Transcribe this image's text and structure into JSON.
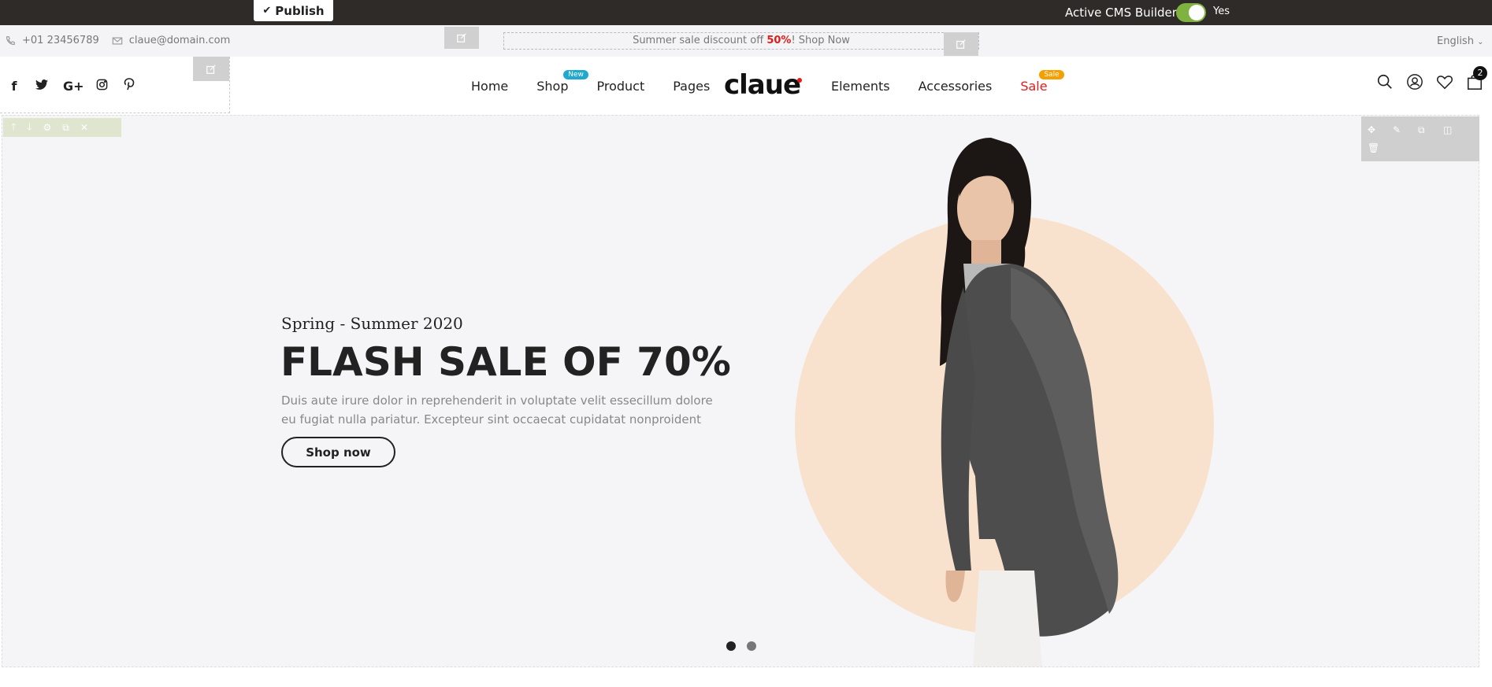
{
  "cms": {
    "publish_label": "Publish",
    "builder_label": "Active CMS Builder",
    "toggle_state": "Yes"
  },
  "topbar": {
    "phone": "+01 23456789",
    "email": "claue@domain.com",
    "promo_prefix": "Summer sale discount off ",
    "promo_highlight": "50%",
    "promo_suffix": "! Shop Now",
    "language": "English"
  },
  "nav": {
    "items": [
      {
        "label": "Home"
      },
      {
        "label": "Shop",
        "badge": "New"
      },
      {
        "label": "Product"
      },
      {
        "label": "Pages"
      }
    ],
    "logo": "claue",
    "items_right": [
      {
        "label": "Elements"
      },
      {
        "label": "Accessories"
      },
      {
        "label": "Sale",
        "badge": "Sale"
      }
    ],
    "cart_count": "2"
  },
  "colors": {
    "accent_red": "#e31b1b",
    "new_badge": "#21a8cf",
    "sale_badge": "#f5a000",
    "toggle_on": "#7fb241"
  },
  "hero": {
    "subheading": "Spring - Summer 2020",
    "headline": "FLASH SALE OF 70%",
    "body": "Duis aute irure dolor in reprehenderit in voluptate velit essecillum dolore eu fugiat nulla pariatur. Excepteur sint occaecat cupidatat nonproident",
    "cta": "Shop now",
    "slides": 2,
    "active_slide": 1
  }
}
